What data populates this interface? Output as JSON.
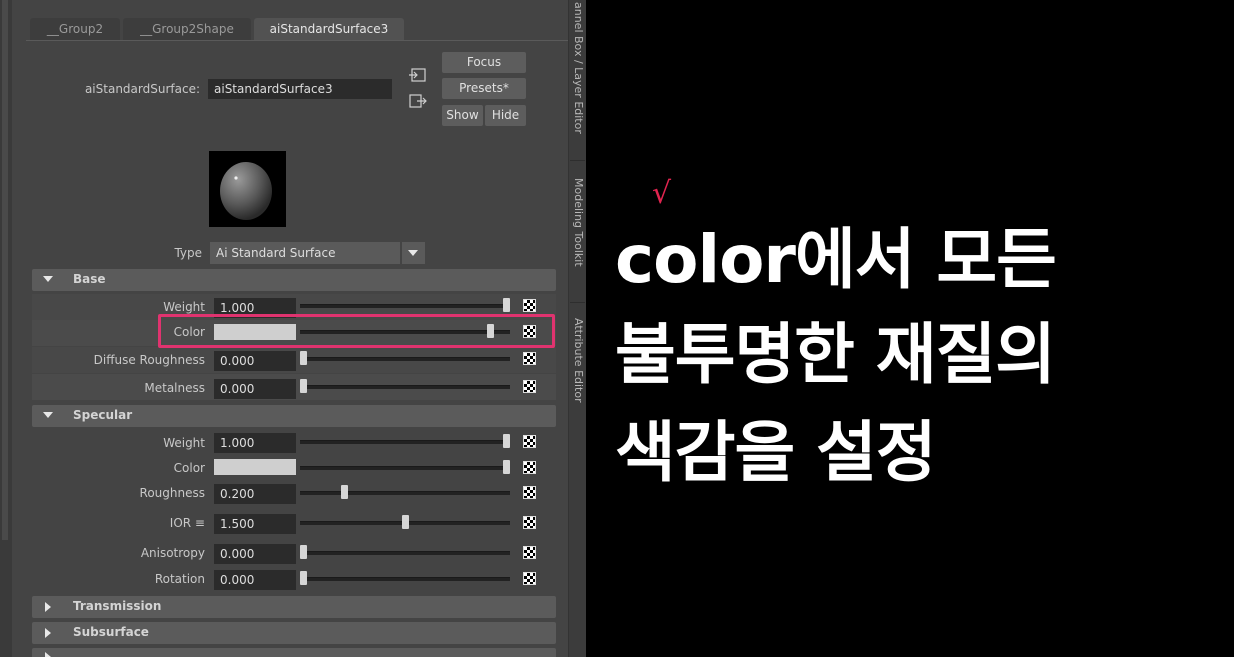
{
  "tabs": [
    "__Group2",
    "__Group2Shape",
    "aiStandardSurface3"
  ],
  "header": {
    "node_label": "aiStandardSurface:",
    "node_value": "aiStandardSurface3",
    "focus": "Focus",
    "presets": "Presets*",
    "show": "Show",
    "hide": "Hide"
  },
  "type_row": {
    "label": "Type",
    "value": "Ai Standard Surface"
  },
  "sections": {
    "base": "Base",
    "specular": "Specular",
    "transmission": "Transmission",
    "subsurface": "Subsurface"
  },
  "base_attrs": {
    "weight_label": "Weight",
    "weight_value": "1.000",
    "weight_level": 1.0,
    "color_label": "Color",
    "color_level": 0.92,
    "diffuse_roughness_label": "Diffuse Roughness",
    "diffuse_roughness_value": "0.000",
    "diffuse_roughness_level": 0.0,
    "metalness_label": "Metalness",
    "metalness_value": "0.000",
    "metalness_level": 0.0
  },
  "specular_attrs": {
    "weight_label": "Weight",
    "weight_value": "1.000",
    "weight_level": 1.0,
    "color_label": "Color",
    "color_level": 1.0,
    "roughness_label": "Roughness",
    "roughness_value": "0.200",
    "roughness_level": 0.2,
    "ior_label": "IOR ≡",
    "ior_value": "1.500",
    "ior_level": 0.5,
    "anisotropy_label": "Anisotropy",
    "anisotropy_value": "0.000",
    "anisotropy_level": 0.0,
    "rotation_label": "Rotation",
    "rotation_value": "0.000",
    "rotation_level": 0.0
  },
  "vertical_tabs": [
    "annel Box / Layer Editor",
    "Modeling Toolkit",
    "Attribute Editor"
  ],
  "caption": {
    "mark": "√",
    "line1": "color에서 모든",
    "line2": "불투명한 재질의",
    "line3": "색감을 설정"
  },
  "colors": {
    "highlight": "#e0336f",
    "check": "#e0244f",
    "swatch": "#cfcfcf"
  }
}
